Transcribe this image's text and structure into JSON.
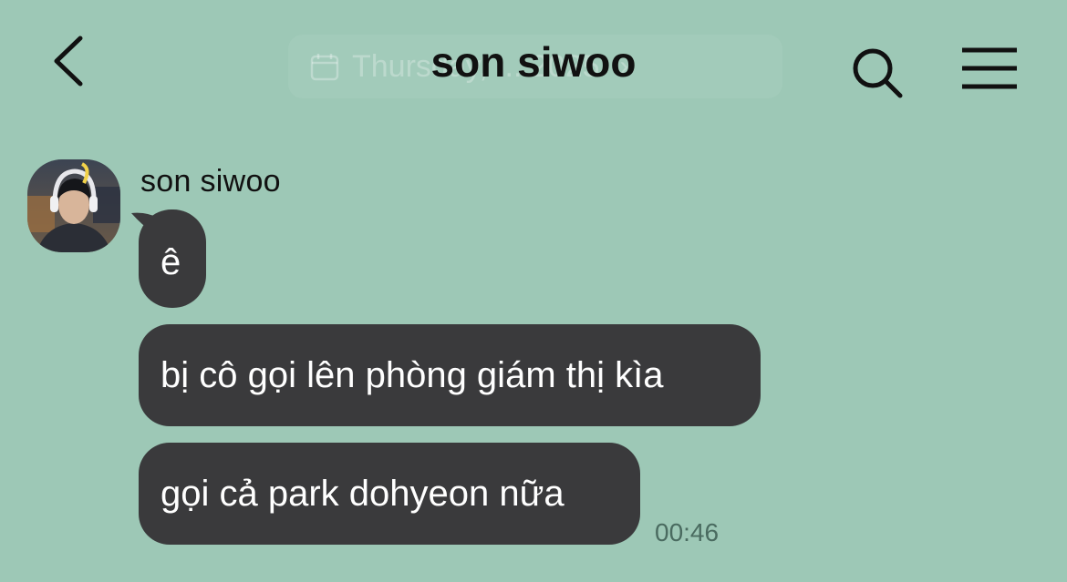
{
  "header": {
    "title": "son siwoo",
    "date_pill_text": "Thursday, ... 2025",
    "back_icon": "chevron-left-icon",
    "search_icon": "search-icon",
    "menu_icon": "menu-icon",
    "date_icon": "calendar-icon"
  },
  "chat": {
    "sender_name": "son siwoo",
    "messages": [
      {
        "text": "ê"
      },
      {
        "text": "bị cô gọi lên phòng giám thị kìa"
      },
      {
        "text": "gọi cả park dohyeon nữa"
      }
    ],
    "timestamp": "00:46"
  },
  "colors": {
    "background": "#9dc8b6",
    "bubble": "#3a3a3c",
    "bubble_text": "#ffffff",
    "timestamp": "#4a6b60"
  }
}
